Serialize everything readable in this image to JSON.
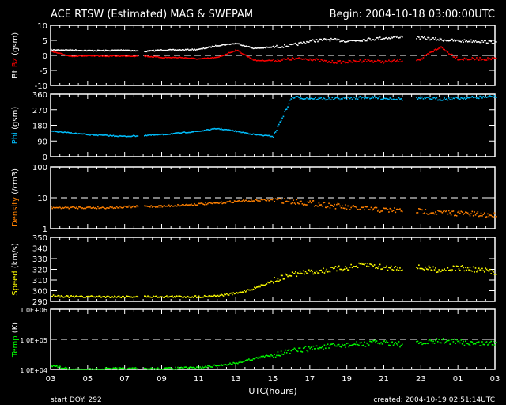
{
  "header": {
    "title": "ACE RTSW (Estimated) MAG & SWEPAM",
    "begin": "Begin: 2004-10-18 03:00:00UTC"
  },
  "footer": {
    "start": "start DOY: 292",
    "created": "created: 2004-10-19 02:51:14UTC",
    "xlabel": "UTC(hours)"
  },
  "chart_data": [
    {
      "type": "scatter",
      "name": "mag",
      "ylabel_parts": [
        "Bt",
        "Bz",
        "(gsm)"
      ],
      "ylim": [
        -10,
        10
      ],
      "ticks": [
        "10",
        "5",
        "0",
        "-5",
        "-10"
      ],
      "tickvals": [
        10,
        5,
        0,
        -5,
        -10
      ],
      "dashed": 0,
      "log": false,
      "series": [
        {
          "name": "Bt",
          "color": "#ffffff",
          "values": [
            2,
            2,
            1.8,
            1.8,
            2,
            1.5,
            2,
            2,
            2.2,
            3.5,
            4.2,
            2.5,
            3,
            3.5,
            5,
            5.5,
            5,
            5.5,
            6,
            6.5,
            6,
            5.5,
            5,
            5,
            4.5,
            4.5
          ]
        },
        {
          "name": "Bz",
          "color": "#ff0000",
          "values": [
            1.5,
            0,
            0,
            0,
            0,
            0,
            -0.5,
            -0.5,
            -1,
            -0.5,
            2,
            -1.5,
            -1.5,
            -1,
            -1,
            -2,
            -2,
            -1.5,
            -2,
            -1.5,
            -1,
            3,
            -1,
            -1,
            -1,
            -1
          ]
        }
      ]
    },
    {
      "type": "scatter",
      "name": "phi",
      "ylabel_parts": [
        "Phi",
        "(gsm)"
      ],
      "ylim": [
        0,
        360
      ],
      "ticks": [
        "360",
        "270",
        "180",
        "90",
        "0"
      ],
      "tickvals": [
        360,
        270,
        180,
        90,
        0
      ],
      "log": false,
      "series": [
        {
          "name": "Phi",
          "color": "#00c0ff",
          "values": [
            150,
            140,
            130,
            125,
            120,
            125,
            130,
            140,
            150,
            165,
            150,
            130,
            120,
            345,
            340,
            335,
            340,
            345,
            340,
            335,
            340,
            335,
            340,
            345,
            350,
            350
          ]
        }
      ]
    },
    {
      "type": "scatter",
      "name": "density",
      "ylabel_parts": [
        "Density",
        "(/cm3)"
      ],
      "ylim": [
        1,
        100
      ],
      "ticks": [
        "100",
        "10",
        "1"
      ],
      "tickvals": [
        100,
        10,
        1
      ],
      "dashed": 10,
      "log": true,
      "series": [
        {
          "name": "Density",
          "color": "#ff8000",
          "values": [
            5,
            5,
            5,
            5,
            5.2,
            5.5,
            5.5,
            6,
            6.5,
            7,
            8,
            8.5,
            9,
            8,
            7,
            6,
            5,
            4.5,
            4.2,
            4,
            3.8,
            3.5,
            3.3,
            3,
            2.8,
            2.5
          ]
        }
      ]
    },
    {
      "type": "scatter",
      "name": "speed",
      "ylabel_parts": [
        "Speed",
        "(km/s)"
      ],
      "ylim": [
        290,
        350
      ],
      "ticks": [
        "350",
        "340",
        "330",
        "320",
        "310",
        "300",
        "290"
      ],
      "tickvals": [
        350,
        340,
        330,
        320,
        310,
        300,
        290
      ],
      "log": false,
      "series": [
        {
          "name": "Speed",
          "color": "#ffff00",
          "values": [
            296,
            295,
            295,
            295,
            295,
            295,
            295,
            295,
            295,
            296,
            298,
            303,
            310,
            316,
            318,
            320,
            322,
            325,
            322,
            322,
            322,
            320,
            322,
            320,
            318,
            318
          ]
        }
      ]
    },
    {
      "type": "scatter",
      "name": "temp",
      "ylabel_parts": [
        "Temp",
        "(K)"
      ],
      "ylim": [
        10000,
        1000000
      ],
      "ticks": [
        "1.0E+06",
        "1.0E+05",
        "1.0E+04"
      ],
      "tickvals": [
        1000000,
        100000,
        10000
      ],
      "dashed": 100000,
      "log": true,
      "series": [
        {
          "name": "Temp",
          "color": "#00ff00",
          "values": [
            14000,
            10500,
            10500,
            11000,
            11000,
            11000,
            11000,
            11500,
            12000,
            14000,
            17000,
            24000,
            32000,
            42000,
            52000,
            60000,
            68000,
            75000,
            85000,
            70000,
            75000,
            95000,
            85000,
            75000,
            80000,
            80000
          ]
        }
      ]
    }
  ],
  "xticks": [
    "03",
    "05",
    "07",
    "09",
    "11",
    "13",
    "15",
    "17",
    "19",
    "21",
    "23",
    "01",
    "03"
  ],
  "gaps": [
    [
      4.7,
      5.0
    ],
    [
      19.0,
      19.7
    ]
  ]
}
